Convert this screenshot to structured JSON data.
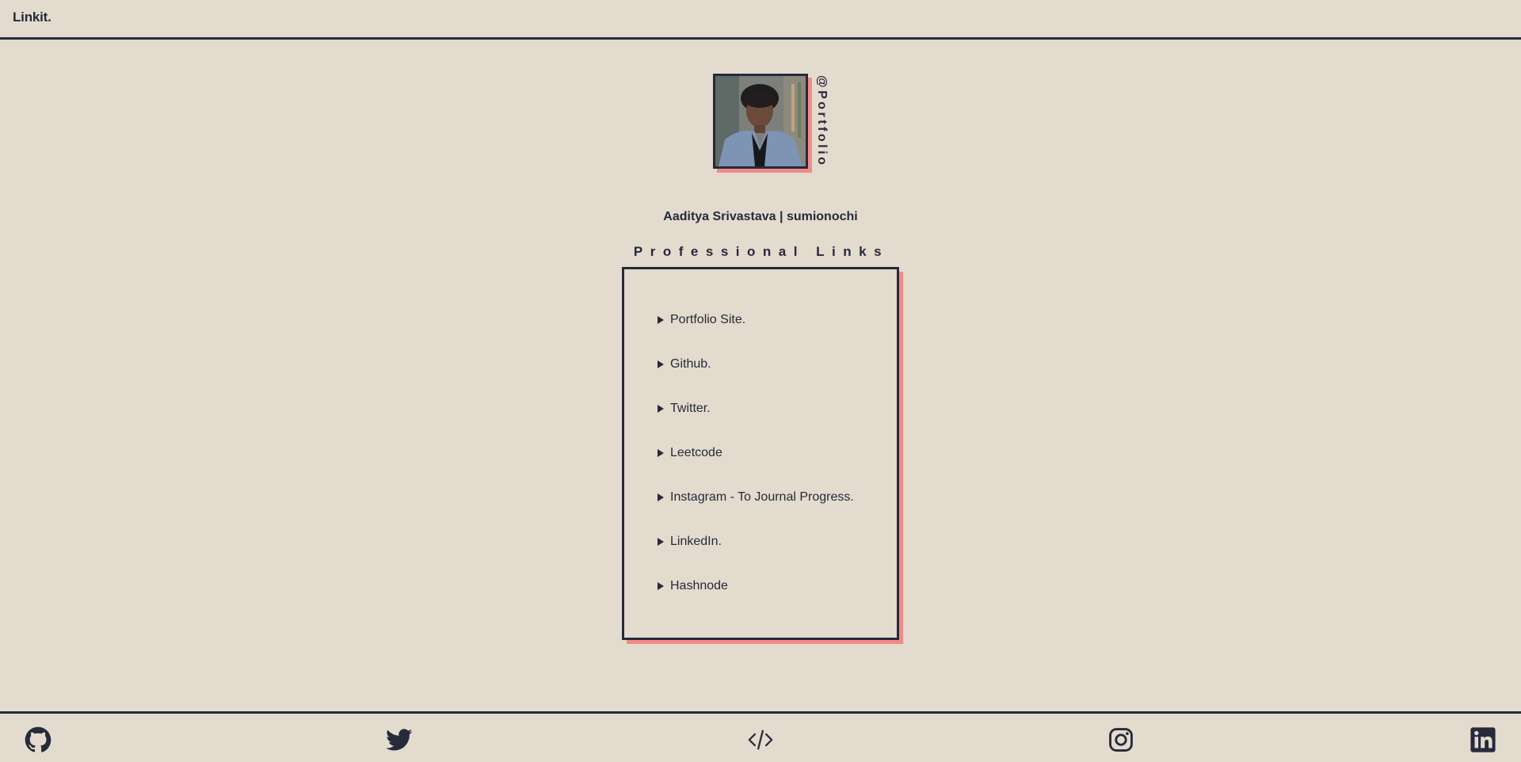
{
  "navbar": {
    "brand": "Linkit."
  },
  "profile": {
    "tag": "@Portfolio",
    "name": "Aaditya Srivastava | sumionochi"
  },
  "links_section": {
    "title": "Professional Links",
    "items": [
      {
        "label": "Portfolio Site."
      },
      {
        "label": "Github."
      },
      {
        "label": "Twitter."
      },
      {
        "label": "Leetcode"
      },
      {
        "label": "Instagram - To Journal Progress."
      },
      {
        "label": "LinkedIn."
      },
      {
        "label": "Hashnode"
      }
    ]
  },
  "footer": {
    "icons": [
      "github-icon",
      "twitter-icon",
      "code-icon",
      "instagram-icon",
      "linkedin-icon"
    ]
  },
  "colors": {
    "background": "#e3dbce",
    "ink": "#262a3a",
    "accent_shadow": "#f28a88"
  }
}
